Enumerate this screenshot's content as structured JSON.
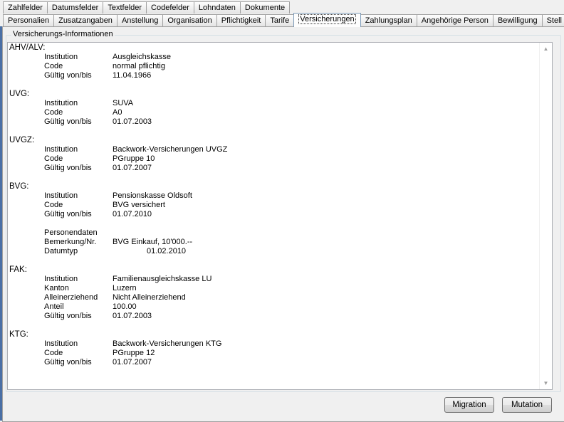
{
  "tabs_row1": [
    "Zahlfelder",
    "Datumsfelder",
    "Textfelder",
    "Codefelder",
    "Lohndaten",
    "Dokumente"
  ],
  "tabs_row2": [
    "Personalien",
    "Zusatzangaben",
    "Anstellung",
    "Organisation",
    "Pflichtigkeit",
    "Tarife",
    "Versicherungen",
    "Zahlungsplan",
    "Angehörige Person",
    "Bewilligung",
    "Stell"
  ],
  "active_tab": "Versicherungen",
  "group_title": "Versicherungs-Informationen",
  "sections": [
    {
      "title": "AHV/ALV:",
      "rows": [
        {
          "label": "Institution",
          "value": "Ausgleichskasse"
        },
        {
          "label": "Code",
          "value": "normal pflichtig"
        },
        {
          "label": "Gültig von/bis",
          "value": "11.04.1966"
        }
      ]
    },
    {
      "title": "UVG:",
      "rows": [
        {
          "label": "Institution",
          "value": "SUVA"
        },
        {
          "label": "Code",
          "value": "A0"
        },
        {
          "label": "Gültig von/bis",
          "value": "01.07.2003"
        }
      ]
    },
    {
      "title": "UVGZ:",
      "rows": [
        {
          "label": "Institution",
          "value": "Backwork-Versicherungen UVGZ"
        },
        {
          "label": "Code",
          "value": "PGruppe 10"
        },
        {
          "label": "Gültig von/bis",
          "value": "01.07.2007"
        }
      ]
    },
    {
      "title": "BVG:",
      "rows": [
        {
          "label": "Institution",
          "value": "Pensionskasse Oldsoft"
        },
        {
          "label": "Code",
          "value": "BVG versichert"
        },
        {
          "label": "Gültig von/bis",
          "value": "01.07.2010"
        }
      ],
      "personendaten": {
        "heading": "Personendaten",
        "rows": [
          {
            "label": "Bemerkung/Nr.",
            "value": "BVG Einkauf, 10'000.--"
          },
          {
            "label": "Datumtyp",
            "value": "01.02.2010"
          }
        ]
      }
    },
    {
      "title": "FAK:",
      "rows": [
        {
          "label": "Institution",
          "value": "Familienausgleichskasse LU"
        },
        {
          "label": "Kanton",
          "value": "Luzern"
        },
        {
          "label": "Alleinerziehend",
          "value": "Nicht Alleinerziehend"
        },
        {
          "label": "Anteil",
          "value": "100.00"
        },
        {
          "label": "Gültig von/bis",
          "value": "01.07.2003"
        }
      ]
    },
    {
      "title": "KTG:",
      "rows": [
        {
          "label": "Institution",
          "value": "Backwork-Versicherungen KTG"
        },
        {
          "label": "Code",
          "value": "PGruppe 12"
        },
        {
          "label": "Gültig von/bis",
          "value": "01.07.2007"
        }
      ]
    }
  ],
  "buttons": {
    "migration": "Migration",
    "mutation": "Mutation"
  }
}
